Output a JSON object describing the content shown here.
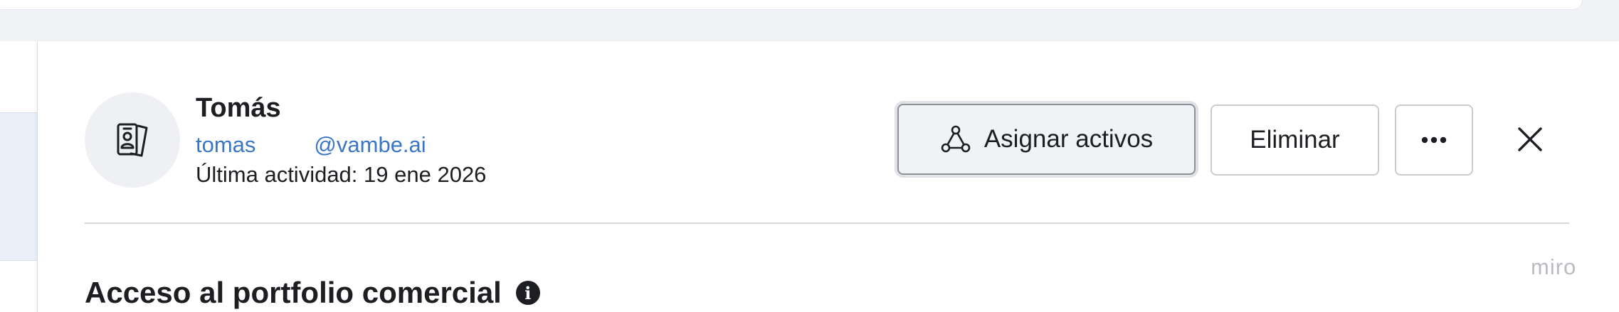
{
  "user": {
    "name": "Tomás",
    "email_local": "tomas",
    "email_domain": "@vambe.ai",
    "last_activity": "Última actividad: 19 ene 2026",
    "avatar_icon": "id-badge-icon"
  },
  "actions": {
    "assign_label": "Asignar activos",
    "assign_icon": "share-nodes-icon",
    "delete_label": "Eliminar",
    "more_label": "···",
    "close_icon": "close-icon"
  },
  "section": {
    "title": "Acceso al portfolio comercial",
    "info_icon": "info-icon",
    "info_glyph": "i"
  },
  "watermark": "miro",
  "colors": {
    "link": "#3b76c4",
    "text": "#1c1e21",
    "active_button_bg": "#f0f2f5"
  }
}
